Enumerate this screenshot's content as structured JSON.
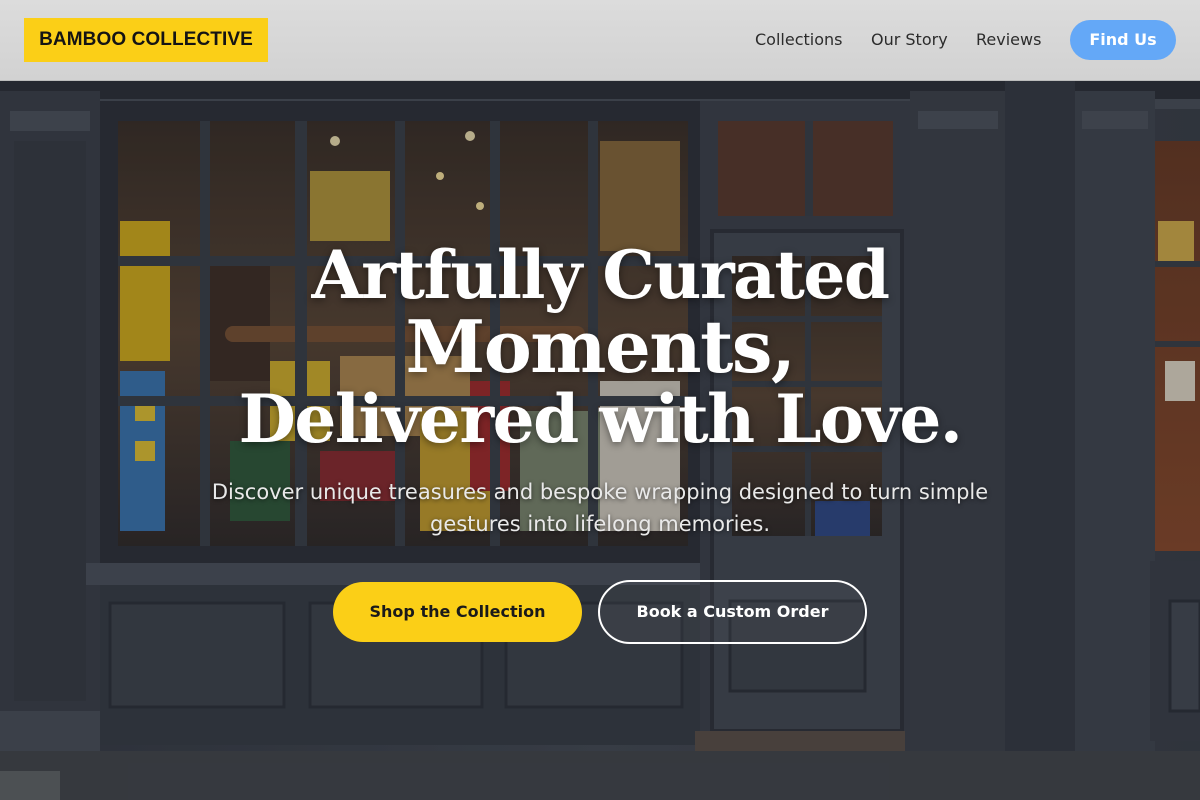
{
  "brand": {
    "name": "BAMBOO COLLECTIVE"
  },
  "nav": {
    "items": [
      {
        "label": "Collections"
      },
      {
        "label": "Our Story"
      },
      {
        "label": "Reviews"
      }
    ],
    "cta_label": "Find Us"
  },
  "hero": {
    "headline_lines": [
      "Artfully Curated",
      "Moments,",
      "Delivered with Love."
    ],
    "subtext_line1": "Discover unique treasures and bespoke wrapping designed to turn simple",
    "subtext_line2": "gestures into lifelong memories.",
    "primary_button": "Shop the Collection",
    "secondary_button": "Book a Custom Order",
    "background_image": "storefront-photo"
  },
  "colors": {
    "accent_yellow": "#fbcf17",
    "cta_blue": "#64a8f7",
    "header_bg": "#d8d8d8",
    "storefront": "#3f4650"
  }
}
